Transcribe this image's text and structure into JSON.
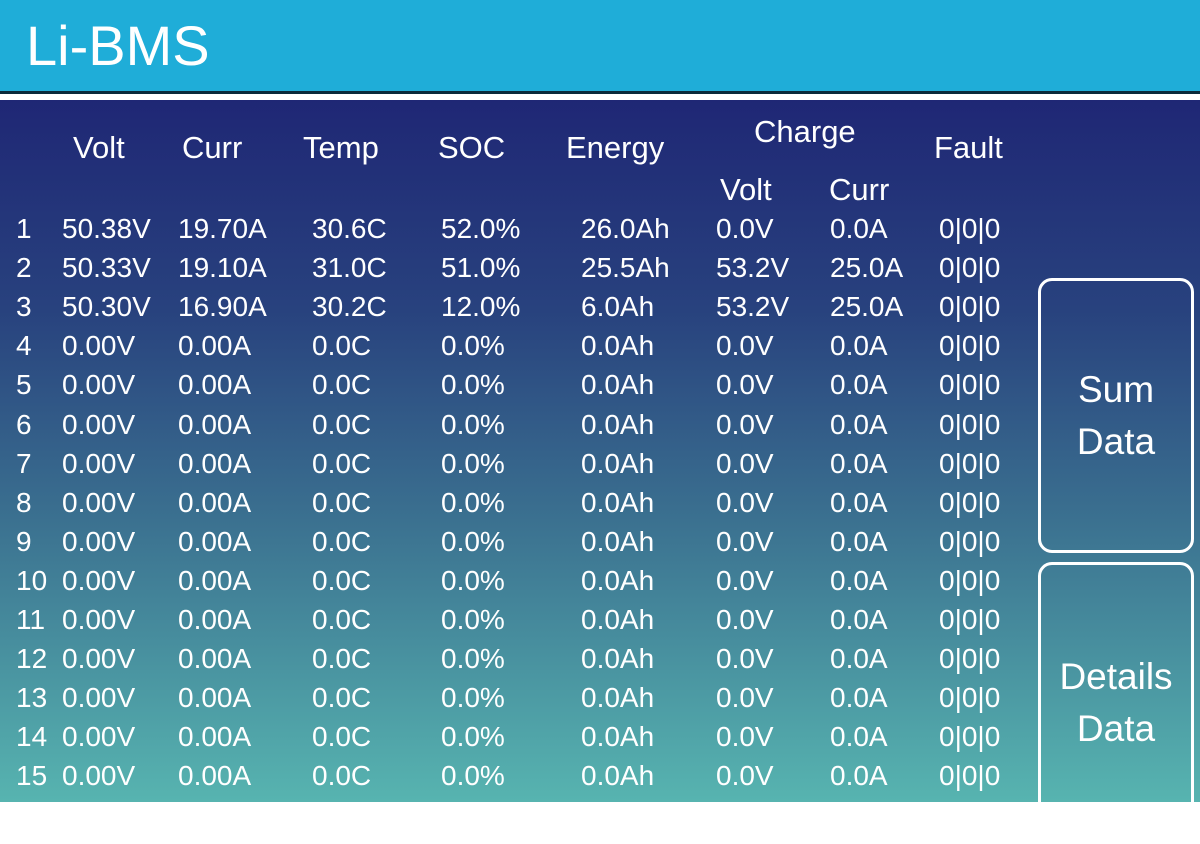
{
  "app": {
    "title": "Li-BMS"
  },
  "columns": {
    "volt": "Volt",
    "curr": "Curr",
    "temp": "Temp",
    "soc": "SOC",
    "energy": "Energy",
    "charge": "Charge",
    "charge_volt": "Volt",
    "charge_curr": "Curr",
    "fault": "Fault"
  },
  "rows": [
    [
      "1",
      "50.38V",
      "19.70A",
      "30.6C",
      "52.0%",
      "26.0Ah",
      "0.0V",
      "0.0A",
      "0|0|0"
    ],
    [
      "2",
      "50.33V",
      "19.10A",
      "31.0C",
      "51.0%",
      "25.5Ah",
      "53.2V",
      "25.0A",
      "0|0|0"
    ],
    [
      "3",
      "50.30V",
      "16.90A",
      "30.2C",
      "12.0%",
      "6.0Ah",
      "53.2V",
      "25.0A",
      "0|0|0"
    ],
    [
      "4",
      "0.00V",
      "0.00A",
      "0.0C",
      "0.0%",
      "0.0Ah",
      "0.0V",
      "0.0A",
      "0|0|0"
    ],
    [
      "5",
      "0.00V",
      "0.00A",
      "0.0C",
      "0.0%",
      "0.0Ah",
      "0.0V",
      "0.0A",
      "0|0|0"
    ],
    [
      "6",
      "0.00V",
      "0.00A",
      "0.0C",
      "0.0%",
      "0.0Ah",
      "0.0V",
      "0.0A",
      "0|0|0"
    ],
    [
      "7",
      "0.00V",
      "0.00A",
      "0.0C",
      "0.0%",
      "0.0Ah",
      "0.0V",
      "0.0A",
      "0|0|0"
    ],
    [
      "8",
      "0.00V",
      "0.00A",
      "0.0C",
      "0.0%",
      "0.0Ah",
      "0.0V",
      "0.0A",
      "0|0|0"
    ],
    [
      "9",
      "0.00V",
      "0.00A",
      "0.0C",
      "0.0%",
      "0.0Ah",
      "0.0V",
      "0.0A",
      "0|0|0"
    ],
    [
      "10",
      "0.00V",
      "0.00A",
      "0.0C",
      "0.0%",
      "0.0Ah",
      "0.0V",
      "0.0A",
      "0|0|0"
    ],
    [
      "11",
      "0.00V",
      "0.00A",
      "0.0C",
      "0.0%",
      "0.0Ah",
      "0.0V",
      "0.0A",
      "0|0|0"
    ],
    [
      "12",
      "0.00V",
      "0.00A",
      "0.0C",
      "0.0%",
      "0.0Ah",
      "0.0V",
      "0.0A",
      "0|0|0"
    ],
    [
      "13",
      "0.00V",
      "0.00A",
      "0.0C",
      "0.0%",
      "0.0Ah",
      "0.0V",
      "0.0A",
      "0|0|0"
    ],
    [
      "14",
      "0.00V",
      "0.00A",
      "0.0C",
      "0.0%",
      "0.0Ah",
      "0.0V",
      "0.0A",
      "0|0|0"
    ],
    [
      "15",
      "0.00V",
      "0.00A",
      "0.0C",
      "0.0%",
      "0.0Ah",
      "0.0V",
      "0.0A",
      "0|0|0"
    ]
  ],
  "buttons": {
    "sum_line1": "Sum",
    "sum_line2": "Data",
    "details_line1": "Details",
    "details_line2": "Data"
  },
  "colors": {
    "header": "#1fadd8",
    "gradient_top": "#1f2775",
    "gradient_bottom": "#57b4b0",
    "text": "#ffffff"
  }
}
